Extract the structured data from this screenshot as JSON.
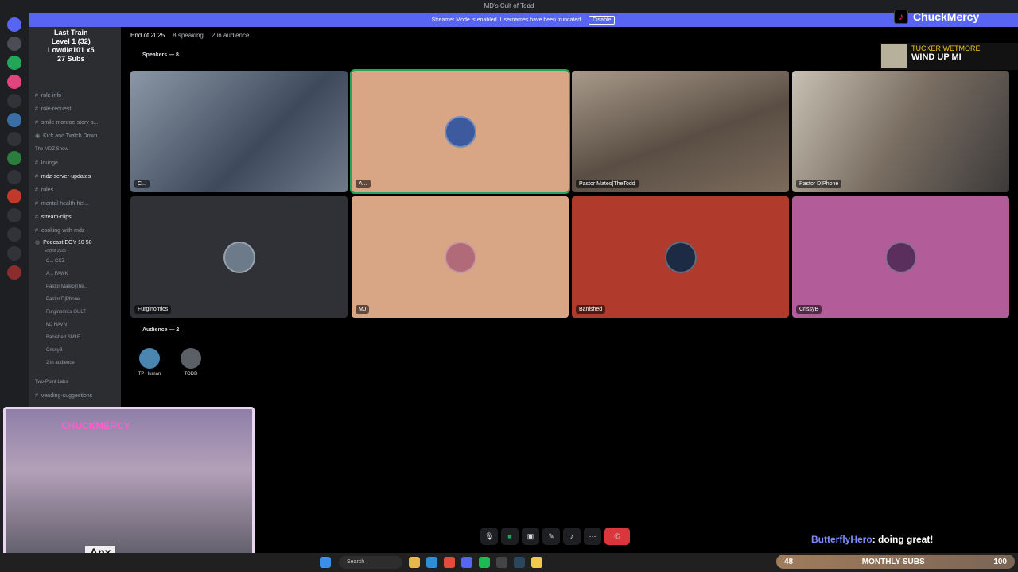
{
  "window": {
    "title": "MD's Cult of Todd"
  },
  "banner": {
    "text": "Streamer Mode is enabled. Usernames have been truncated.",
    "button": "Disable"
  },
  "sidebar": {
    "items": [
      {
        "label": "role-info",
        "type": "channel"
      },
      {
        "label": "role-request",
        "type": "channel"
      },
      {
        "label": "smile-monroe-story-s...",
        "type": "channel"
      },
      {
        "label": "Kick and Twitch Down",
        "type": "channel"
      },
      {
        "label": "The MDZ Show",
        "type": "category"
      },
      {
        "label": "lounge",
        "type": "channel"
      },
      {
        "label": "mdz-server-updates",
        "type": "channel"
      },
      {
        "label": "rules",
        "type": "channel"
      },
      {
        "label": "mental-health-hel...",
        "type": "channel"
      },
      {
        "label": "stream-clips",
        "type": "channel"
      },
      {
        "label": "cooking-with-mdz",
        "type": "channel"
      },
      {
        "label": "Podcast EOY",
        "type": "voice",
        "sub": "End of 2025",
        "count": "10",
        "limit": "50"
      }
    ],
    "voice_members": [
      "C...",
      "A...",
      "Pastor Mateo|The...",
      "Pastor D|Phone",
      "Furginomics",
      "MJ",
      "Banished",
      "CrissyB",
      "2 in audience"
    ],
    "member_tags": [
      "CCZ",
      "FAWK",
      "",
      "",
      "GULT",
      "HAVN",
      "SMLE",
      "",
      ""
    ],
    "footer_items": [
      {
        "label": "Two-Point Labs",
        "type": "category"
      },
      {
        "label": "vending-suggestions",
        "type": "channel"
      }
    ]
  },
  "stage": {
    "title": "End of 2025",
    "speaking": "8 speaking",
    "audience_count": "2 in audience",
    "speakers_label": "Speakers — 8",
    "audience_label": "Audience — 2",
    "speakers": [
      {
        "name": "C...",
        "bg": "#6f7a8a",
        "video": true
      },
      {
        "name": "A...",
        "bg": "#d8a585",
        "video": false,
        "speaking": true
      },
      {
        "name": "Pastor Mateo|TheTodd",
        "bg": "#6e6258",
        "video": true
      },
      {
        "name": "Pastor D|Phone",
        "bg": "#9c8f80",
        "video": true
      },
      {
        "name": "Furginomics",
        "bg": "#2f3136",
        "video": false
      },
      {
        "name": "MJ",
        "bg": "#d8a585",
        "video": false
      },
      {
        "name": "Banished",
        "bg": "#b03a2c",
        "video": false
      },
      {
        "name": "CrissyB",
        "bg": "#b25d9a",
        "video": false
      }
    ],
    "audience": [
      {
        "name": "TP Human",
        "color": "#4a86b0"
      },
      {
        "name": "TODD",
        "color": "#5b5f66"
      }
    ]
  },
  "overlay": {
    "tiktok_name": "ChuckMercy",
    "top_left_lines": [
      "Last Train",
      "Level 1 (32)",
      "Lowdie101 x5",
      "27 Subs"
    ],
    "song_artist": "TUCKER WETMORE",
    "song_title": "WIND UP MI",
    "chat_user": "ButterflyHero",
    "chat_text": ": doing great!",
    "webcam_neon": "CHUCKMERCY",
    "webcam_caption": "Anx",
    "subs_count": "48",
    "subs_label": "MONTHLY SUBS",
    "subs_goal": "100"
  },
  "taskbar": {
    "search_placeholder": "Search"
  },
  "colors": {
    "accent": "#5865f2",
    "end_call": "#da373c",
    "speaking": "#23a55a"
  }
}
